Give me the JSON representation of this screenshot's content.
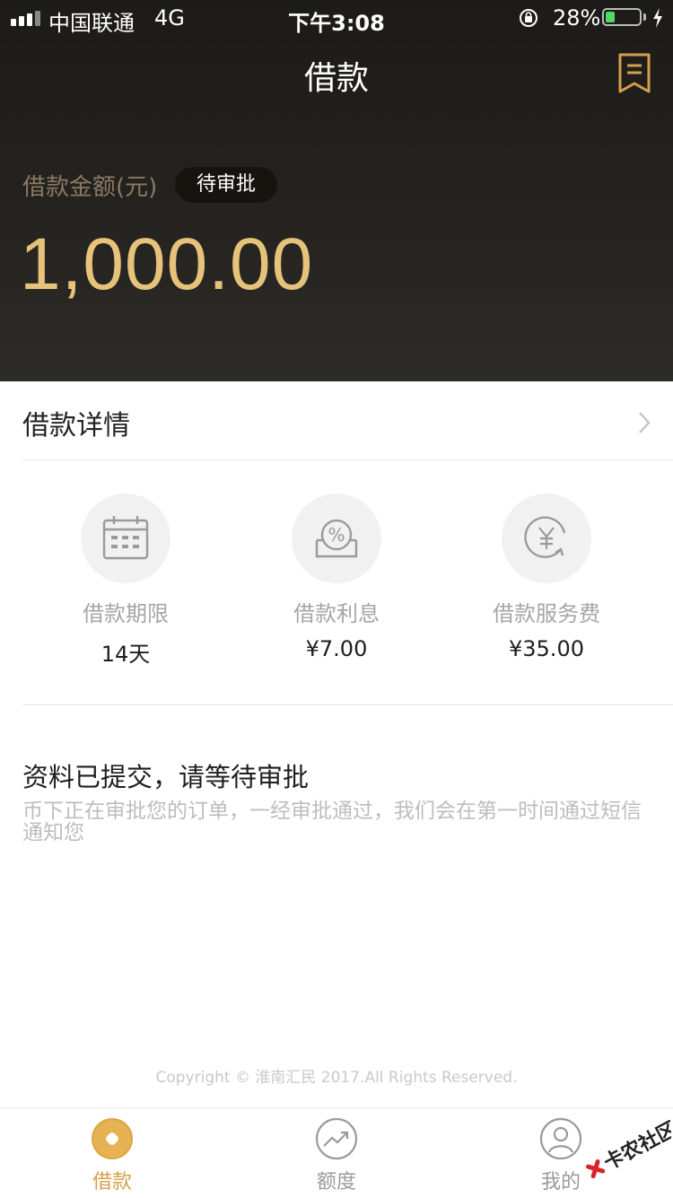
{
  "status_bar": {
    "carrier": "中国联通",
    "network": "4G",
    "time": "下午3:08",
    "battery_percent": "28%",
    "battery_level": 0.28
  },
  "header": {
    "title": "借款",
    "amount_label": "借款金额(元)",
    "status_badge": "待审批",
    "amount": "1,000.00"
  },
  "details": {
    "label": "借款详情"
  },
  "info_items": [
    {
      "title": "借款期限",
      "value": "14天",
      "icon": "calendar-icon"
    },
    {
      "title": "借款利息",
      "value": "¥7.00",
      "icon": "percent-icon"
    },
    {
      "title": "借款服务费",
      "value": "¥35.00",
      "icon": "yuan-icon"
    }
  ],
  "message": {
    "title": "资料已提交，请等待审批",
    "body": "币下正在审批您的订单，一经审批通过，我们会在第一时间通过短信通知您"
  },
  "footer": {
    "copyright": "Copyright © 淮南汇民 2017.All Rights Reserved."
  },
  "tabbar": {
    "tabs": [
      {
        "label": "借款",
        "icon": "coin-icon",
        "active": true
      },
      {
        "label": "额度",
        "icon": "trend-icon",
        "active": false
      },
      {
        "label": "我的",
        "icon": "user-icon",
        "active": false
      }
    ]
  },
  "watermark": {
    "text": "卡农社区"
  },
  "colors": {
    "accent": "#e7c27a",
    "tab_active": "#d6a04a",
    "header_bg": "#24221f"
  }
}
